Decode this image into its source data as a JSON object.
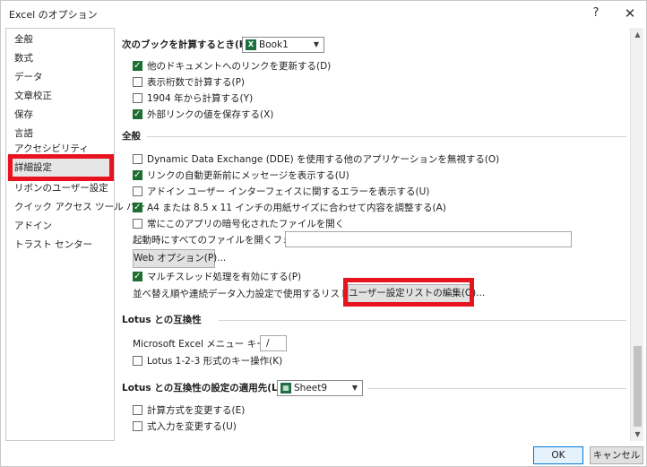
{
  "window": {
    "title": "Excel のオプション",
    "help_icon": "?",
    "close_icon": "✕"
  },
  "sidebar": {
    "items": [
      {
        "label": "全般"
      },
      {
        "label": "数式"
      },
      {
        "label": "データ"
      },
      {
        "label": "文章校正"
      },
      {
        "label": "保存"
      },
      {
        "label": "言語"
      },
      {
        "label": "アクセシビリティ"
      },
      {
        "label": "詳細設定",
        "selected": true
      },
      {
        "label": "リボンのユーザー設定"
      },
      {
        "label": "クイック アクセス ツール バー"
      },
      {
        "label": "アドイン"
      },
      {
        "label": "トラスト センター"
      }
    ]
  },
  "workbook_calc": {
    "label": "次のブックを計算するとき(H):",
    "selected_book": "Book1",
    "options": [
      {
        "label": "他のドキュメントへのリンクを更新する(D)",
        "checked": true
      },
      {
        "label": "表示桁数で計算する(P)",
        "checked": false
      },
      {
        "label": "1904 年から計算する(Y)",
        "checked": false
      },
      {
        "label": "外部リンクの値を保存する(X)",
        "checked": true
      }
    ]
  },
  "general": {
    "heading": "全般",
    "options": [
      {
        "label": "Dynamic Data Exchange (DDE) を使用する他のアプリケーションを無視する(O)",
        "checked": false
      },
      {
        "label": "リンクの自動更新前にメッセージを表示する(U)",
        "checked": true
      },
      {
        "label": "アドイン ユーザー インターフェイスに関するエラーを表示する(U)",
        "checked": false
      },
      {
        "label": "A4 または 8.5 x 11 インチの用紙サイズに合わせて内容を調整する(A)",
        "checked": true
      },
      {
        "label": "常にこのアプリの暗号化されたファイルを開く",
        "checked": false
      }
    ],
    "startup_folder_label": "起動時にすべてのファイルを開くフォルダー(L):",
    "startup_folder_value": "",
    "web_options_button": "Web オプション(P)...",
    "multithread_label": "マルチスレッド処理を有効にする(P)",
    "multithread_checked": true,
    "custom_list_label": "並べ替え順や連続データ入力設定で使用するリストを作成します:",
    "custom_list_button": "ユーザー設定リストの編集(O)..."
  },
  "lotus_compat": {
    "heading": "Lotus との互換性",
    "menu_key_label": "Microsoft Excel メニュー キー(M):",
    "menu_key_value": "/",
    "nav_keys_label": "Lotus 1-2-3 形式のキー操作(K)",
    "nav_keys_checked": false
  },
  "lotus_settings": {
    "label": "Lotus との互換性の設定の適用先(L):",
    "selected_sheet": "Sheet9",
    "options": [
      {
        "label": "計算方式を変更する(E)",
        "checked": false
      },
      {
        "label": "式入力を変更する(U)",
        "checked": false
      }
    ]
  },
  "footer": {
    "ok": "OK",
    "cancel": "キャンセル"
  },
  "colors": {
    "highlight": "#e8131f",
    "checkbox_checked": "#1e6e31"
  }
}
